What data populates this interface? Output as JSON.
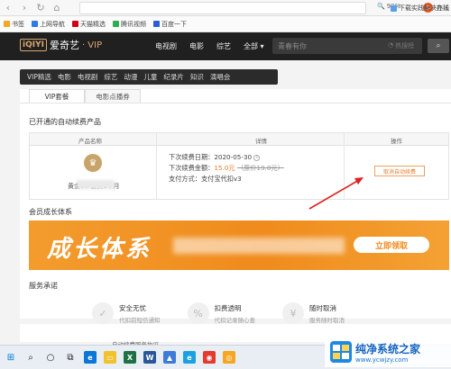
{
  "browser": {
    "zoom": "90%",
    "right_text": "在线"
  },
  "bookmarks": [
    {
      "label": "书签",
      "color": "#f5a623"
    },
    {
      "label": "上网导航",
      "color": "#2b7de1"
    },
    {
      "label": "天猫精选",
      "color": "#d0021b"
    },
    {
      "label": "腾讯视频",
      "color": "#2fae4f"
    },
    {
      "label": "百度一下",
      "color": "#2e5bd6"
    }
  ],
  "bookmarks_right": "下载实践解决办法",
  "header": {
    "logo_box": "iQIYI",
    "logo_text": "爱奇艺",
    "logo_vip": "· VIP",
    "nav": [
      "电视剧",
      "电影",
      "综艺",
      "全部 ▾"
    ],
    "search_placeholder": "青春有你",
    "hot_search": "热搜榜",
    "search_btn": "⌕"
  },
  "categories": [
    "VIP精选",
    "电影",
    "电视剧",
    "综艺",
    "动漫",
    "儿童",
    "纪录片",
    "知识",
    "演唱会"
  ],
  "tabs": [
    {
      "label": "VIP套餐",
      "active": true
    },
    {
      "label": "电影点播券",
      "active": false
    }
  ],
  "auto_renew": {
    "title": "已开通的自动续费产品",
    "headers": [
      "产品名称",
      "详情",
      "操作"
    ],
    "product_name": "黄金VIP会员1个月",
    "next_date_label": "下次续费日期：",
    "next_date": "2020-05-30",
    "amount_label": "下次续费金额：",
    "amount": "15.0元",
    "orig_price": "（原价19.8元）",
    "pay_label": "支付方式：",
    "pay_value": "支付宝代扣v3",
    "cancel_label": "取消自动续费"
  },
  "growth": {
    "title": "会员成长体系",
    "banner_text": "成长体系",
    "banner_button": "立即领取"
  },
  "service": {
    "title": "服务承诺",
    "items": [
      {
        "icon": "shield-icon",
        "glyph": "✓",
        "title": "安全无忧",
        "sub": "代扣前短信通知"
      },
      {
        "icon": "receipt-icon",
        "glyph": "%",
        "title": "扣费透明",
        "sub": "代扣记录随心查"
      },
      {
        "icon": "cancel-icon",
        "glyph": "¥",
        "title": "随时取消",
        "sub": "服务随时取消"
      }
    ]
  },
  "bottom_strip_text": "自动续费服务协议",
  "taskbar": [
    {
      "name": "start-icon",
      "glyph": "⊞",
      "bg": "",
      "fg": "#0078d7"
    },
    {
      "name": "search-icon",
      "glyph": "⌕",
      "bg": "",
      "fg": "#222"
    },
    {
      "name": "cortana-icon",
      "glyph": "○",
      "bg": "",
      "fg": "#222"
    },
    {
      "name": "task-view-icon",
      "glyph": "⧉",
      "bg": "",
      "fg": "#222"
    },
    {
      "name": "edge-icon",
      "glyph": "e",
      "bg": "#0a76d6",
      "fg": "#fff"
    },
    {
      "name": "explorer-icon",
      "glyph": "▭",
      "bg": "#f2c12e",
      "fg": "#fff"
    },
    {
      "name": "excel-icon",
      "glyph": "X",
      "bg": "#1e7145",
      "fg": "#fff"
    },
    {
      "name": "word-icon",
      "glyph": "W",
      "bg": "#2b579a",
      "fg": "#fff"
    },
    {
      "name": "photos-icon",
      "glyph": "▲",
      "bg": "#3d7bd8",
      "fg": "#fff"
    },
    {
      "name": "ie-icon",
      "glyph": "e",
      "bg": "#1ba1e2",
      "fg": "#fff"
    },
    {
      "name": "chrome-icon",
      "glyph": "◉",
      "bg": "#e33b2e",
      "fg": "#fff"
    },
    {
      "name": "browser-icon",
      "glyph": "◎",
      "bg": "#f6a623",
      "fg": "#fff"
    }
  ],
  "watermark": {
    "title": "纯净系统之家",
    "url": "www.ycwjzy.com"
  },
  "colors": {
    "accent": "#e87a2b",
    "vip_gold": "#d9a870",
    "header_bg": "#202020"
  }
}
